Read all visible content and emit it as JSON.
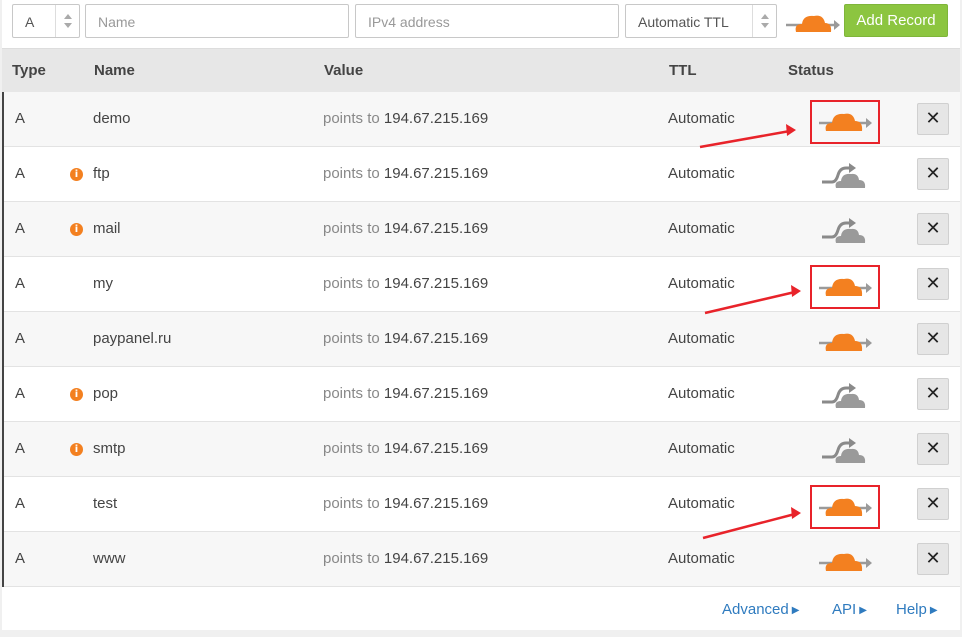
{
  "form": {
    "type_value": "A",
    "name_placeholder": "Name",
    "value_placeholder": "IPv4 address",
    "ttl_value": "Automatic TTL",
    "add_button_label": "Add Record",
    "proxy_status": "orange-cloud-icon"
  },
  "table": {
    "headers": {
      "type": "Type",
      "name": "Name",
      "value": "Value",
      "ttl": "TTL",
      "status": "Status"
    },
    "rows": [
      {
        "type": "A",
        "name": "demo",
        "points_to_label": "points to",
        "ip": "194.67.215.169",
        "ttl": "Automatic",
        "status": "proxied",
        "info": false,
        "highlighted": true
      },
      {
        "type": "A",
        "name": "ftp",
        "points_to_label": "points to",
        "ip": "194.67.215.169",
        "ttl": "Automatic",
        "status": "dns-only",
        "info": true,
        "highlighted": false
      },
      {
        "type": "A",
        "name": "mail",
        "points_to_label": "points to",
        "ip": "194.67.215.169",
        "ttl": "Automatic",
        "status": "dns-only",
        "info": true,
        "highlighted": false
      },
      {
        "type": "A",
        "name": "my",
        "points_to_label": "points to",
        "ip": "194.67.215.169",
        "ttl": "Automatic",
        "status": "proxied",
        "info": false,
        "highlighted": true
      },
      {
        "type": "A",
        "name": "paypanel.ru",
        "points_to_label": "points to",
        "ip": "194.67.215.169",
        "ttl": "Automatic",
        "status": "proxied",
        "info": false,
        "highlighted": false
      },
      {
        "type": "A",
        "name": "pop",
        "points_to_label": "points to",
        "ip": "194.67.215.169",
        "ttl": "Automatic",
        "status": "dns-only",
        "info": true,
        "highlighted": false
      },
      {
        "type": "A",
        "name": "smtp",
        "points_to_label": "points to",
        "ip": "194.67.215.169",
        "ttl": "Automatic",
        "status": "dns-only",
        "info": true,
        "highlighted": false
      },
      {
        "type": "A",
        "name": "test",
        "points_to_label": "points to",
        "ip": "194.67.215.169",
        "ttl": "Automatic",
        "status": "proxied",
        "info": false,
        "highlighted": true
      },
      {
        "type": "A",
        "name": "www",
        "points_to_label": "points to",
        "ip": "194.67.215.169",
        "ttl": "Automatic",
        "status": "proxied",
        "info": false,
        "highlighted": false
      }
    ],
    "info_icon_glyph": "i",
    "delete_glyph": "✕"
  },
  "footer": {
    "advanced_label": "Advanced",
    "api_label": "API",
    "help_label": "Help"
  },
  "colors": {
    "accent_green": "#8cc540",
    "cloud_orange": "#f38020",
    "cloud_gray": "#999999",
    "annotation_red": "#e8232a",
    "link_blue": "#2f7bbf"
  }
}
